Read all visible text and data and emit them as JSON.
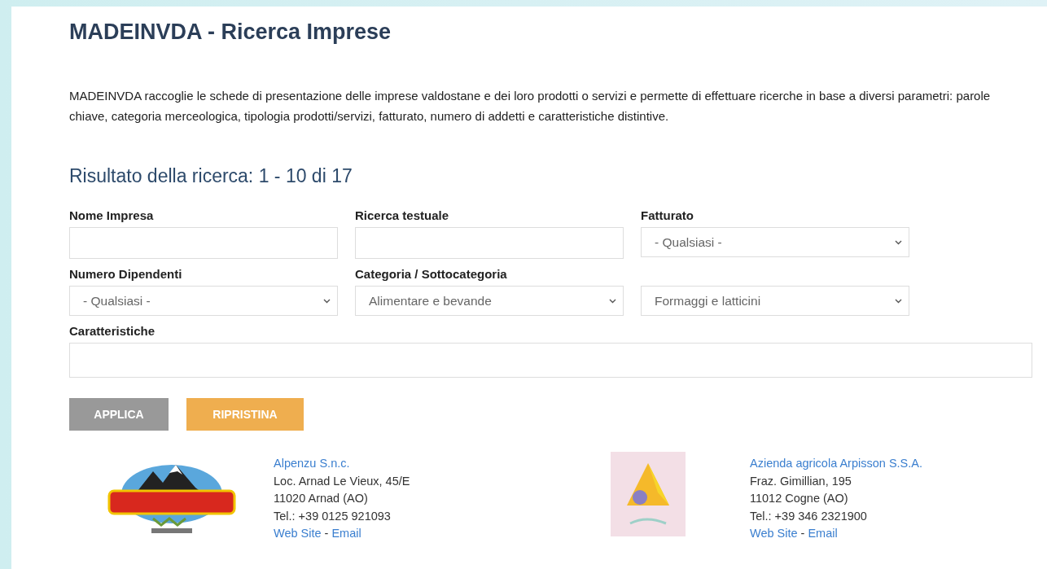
{
  "page": {
    "title": "MADEINVDA - Ricerca Imprese",
    "description": "MADEINVDA raccoglie le schede di presentazione delle imprese valdostane e dei loro prodotti o servizi e permette di effettuare ricerche in base a diversi parametri: parole chiave, categoria merceologica, tipologia prodotti/servizi, fatturato, numero di addetti e caratteristiche distintive."
  },
  "results_heading": "Risultato della ricerca: 1 - 10 di 17",
  "filters": [
    {
      "kind": "text",
      "label": "Nome Impresa"
    },
    {
      "kind": "text",
      "label": "Ricerca testuale"
    },
    {
      "kind": "select",
      "label": "Fatturato",
      "value": "- Qualsiasi -"
    },
    {
      "kind": "select",
      "label": "Numero Dipendenti",
      "value": "- Qualsiasi -"
    },
    {
      "kind": "select",
      "label": "Categoria / Sottocategoria",
      "value": "Alimentare e bevande"
    },
    {
      "kind": "select",
      "value": "Formaggi e latticini"
    },
    {
      "kind": "wide",
      "label": "Caratteristiche"
    }
  ],
  "buttons": [
    {
      "label": "APPLICA",
      "kind": "primary"
    },
    {
      "label": "RIPRISTINA",
      "kind": "reset"
    }
  ],
  "results": [
    {
      "kind": "mountain",
      "name": "Alpenzu S.n.c.",
      "address": "Loc. Arnad Le Vieux, 45/E",
      "city": "11020 Arnad (AO)",
      "phone": "Tel.: +39 0125 921093",
      "website": "Web Site",
      "separator": "-",
      "email": "Email"
    },
    {
      "kind": "triangle",
      "name": "Azienda agricola Arpisson S.S.A.",
      "address": "Fraz. Gimillian, 195",
      "city": "11012 Cogne (AO)",
      "phone": "Tel.: +39 346 2321900",
      "website": "Web Site",
      "separator": "-",
      "email": "Email"
    }
  ]
}
